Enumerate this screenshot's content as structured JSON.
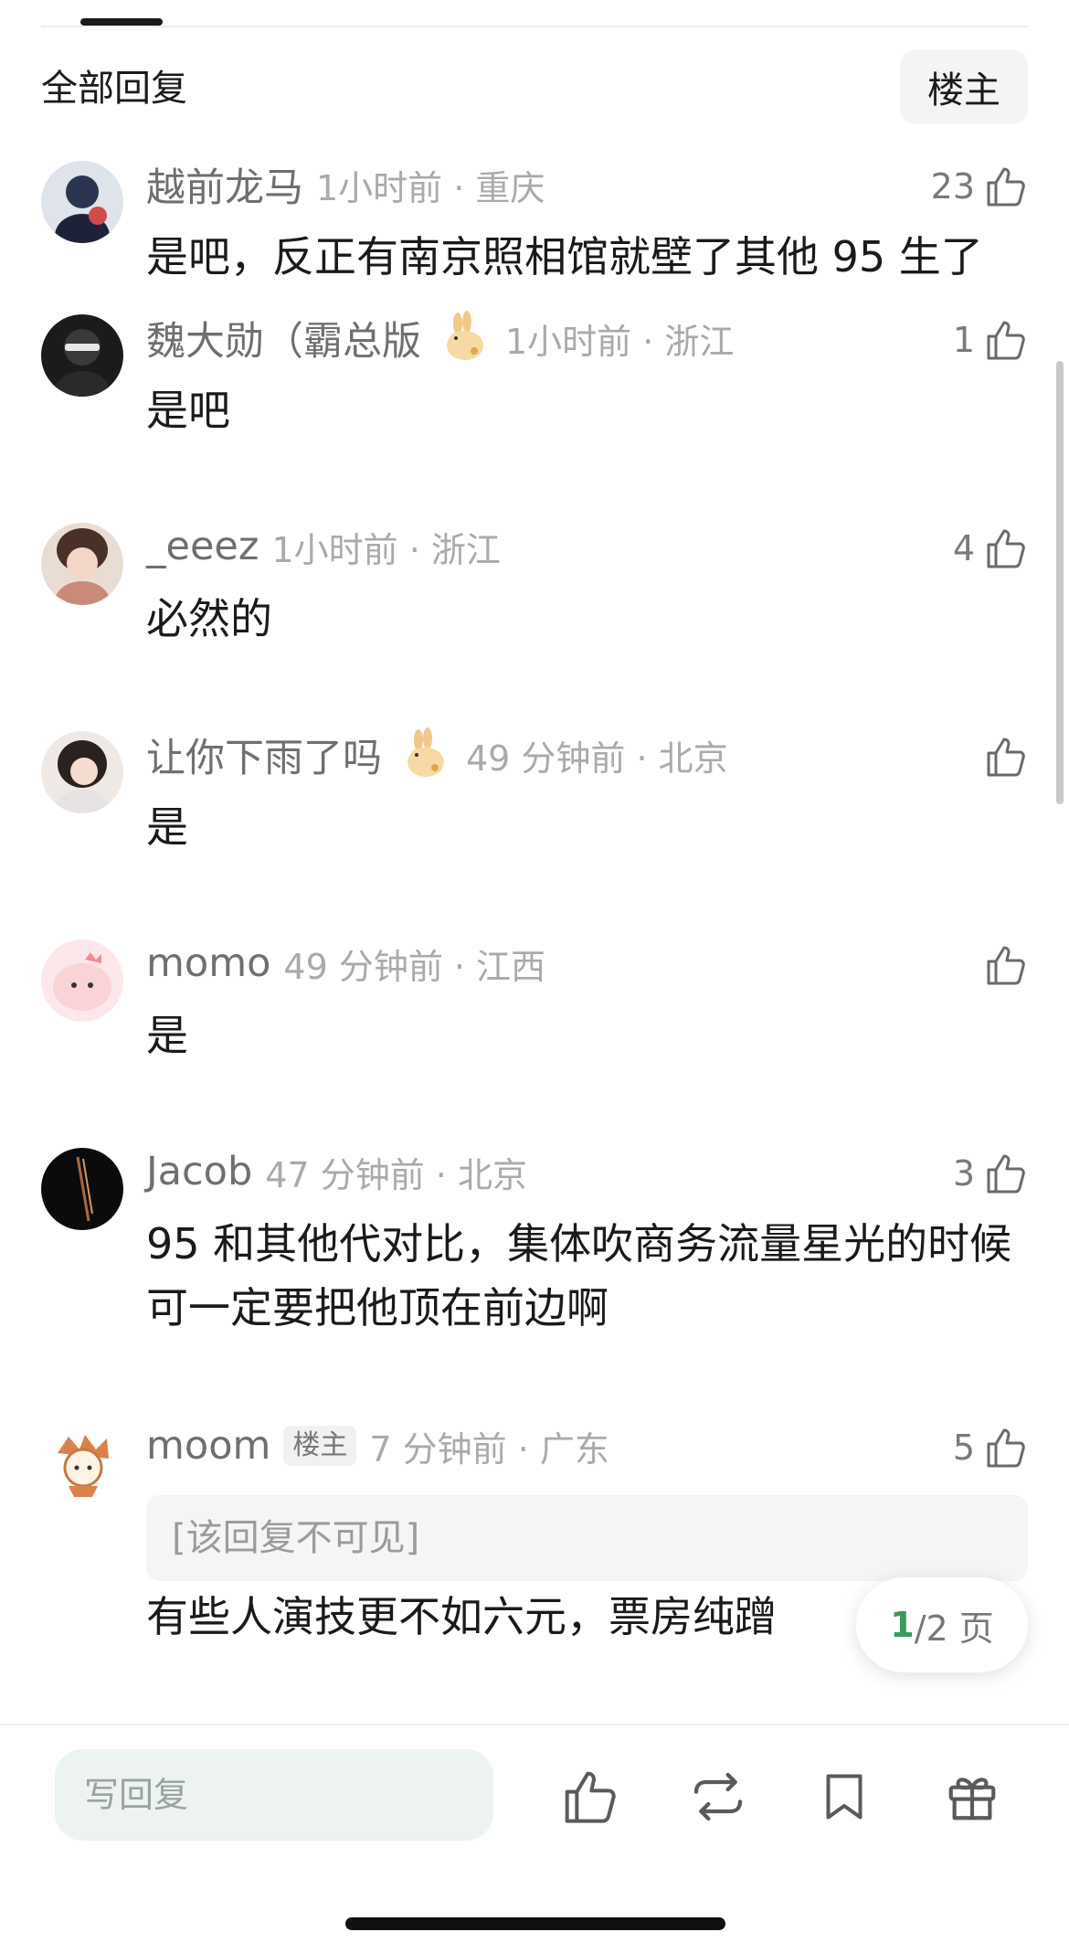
{
  "header": {
    "section_title": "全部回复",
    "op_filter_label": "楼主"
  },
  "comments": [
    {
      "username": "越前龙马",
      "meta": "1小时前 · 重庆",
      "likes": "23",
      "has_badge": false,
      "text": "是吧，反正有南京照相馆就壁了其他 95 生了"
    },
    {
      "username": "魏大勋（霸总版",
      "meta": "1小时前 · 浙江",
      "likes": "1",
      "has_badge": true,
      "text": "是吧"
    },
    {
      "username": "_eeez",
      "meta": "1小时前 · 浙江",
      "likes": "4",
      "has_badge": false,
      "text": "必然的"
    },
    {
      "username": "让你下雨了吗",
      "meta": "49 分钟前 · 北京",
      "likes": "",
      "has_badge": true,
      "text": "是"
    },
    {
      "username": "momo",
      "meta": "49 分钟前 · 江西",
      "likes": "",
      "has_badge": false,
      "text": "是"
    },
    {
      "username": "Jacob",
      "meta": "47 分钟前 · 北京",
      "likes": "3",
      "has_badge": false,
      "text": "95 和其他代对比，集体吹商务流量星光的时候可一定要把他顶在前边啊"
    },
    {
      "username": "moom",
      "op_tag": "楼主",
      "meta": "7 分钟前 · 广东",
      "likes": "5",
      "has_badge": false,
      "hidden_quote": "[该回复不可见]",
      "text": "有些人演技更不如六元，票房纯蹭"
    }
  ],
  "pagination": {
    "current": "1",
    "total_suffix": "/2 页"
  },
  "bottom_bar": {
    "reply_placeholder": "写回复"
  },
  "colors": {
    "accent_green": "#3a9a5b",
    "meta_gray": "#aaaaaa",
    "input_bg": "#edf3ef"
  },
  "icons": [
    "thumbs-up-icon",
    "repost-icon",
    "bookmark-icon",
    "gift-icon",
    "rabbit-badge-icon"
  ]
}
